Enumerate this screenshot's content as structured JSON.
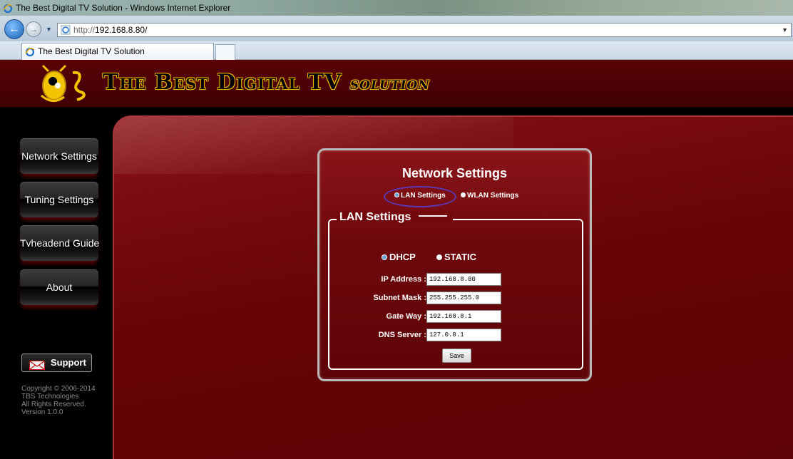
{
  "browser": {
    "window_title": "The Best Digital TV Solution - Windows Internet Explorer",
    "url_prefix": "http://",
    "url_host": "192.168.8.80/",
    "tab_title": "The Best Digital TV Solution"
  },
  "header": {
    "brand_main": "The Best Digital TV",
    "brand_script": "solution"
  },
  "sidebar": {
    "items": [
      {
        "label": "Network Settings"
      },
      {
        "label": "Tuning Settings"
      },
      {
        "label": "Tvheadend Guide"
      },
      {
        "label": "About"
      }
    ],
    "support_label": "Support",
    "copyright": [
      "Copyright © 2006-2014",
      "TBS Technologies",
      "All Rights Reserved.",
      "Version 1.0.0"
    ]
  },
  "settings": {
    "title": "Network Settings",
    "modes": [
      {
        "label": "LAN Settings",
        "selected": true
      },
      {
        "label": "WLAN Settings",
        "selected": false
      }
    ],
    "section_title": "LAN Settings",
    "ip_modes": [
      {
        "label": "DHCP",
        "selected": true
      },
      {
        "label": "STATIC",
        "selected": false
      }
    ],
    "fields": [
      {
        "label": "IP Address :",
        "value": "192.168.8.80"
      },
      {
        "label": "Subnet Mask :",
        "value": "255.255.255.0"
      },
      {
        "label": "Gate Way :",
        "value": "192.168.8.1"
      },
      {
        "label": "DNS Server :",
        "value": "127.0.0.1"
      }
    ],
    "save_label": "Save"
  },
  "colors": {
    "panel_red": "#6e080c",
    "accent_gold": "#e8b000",
    "highlight_ring": "#5a38b8"
  }
}
